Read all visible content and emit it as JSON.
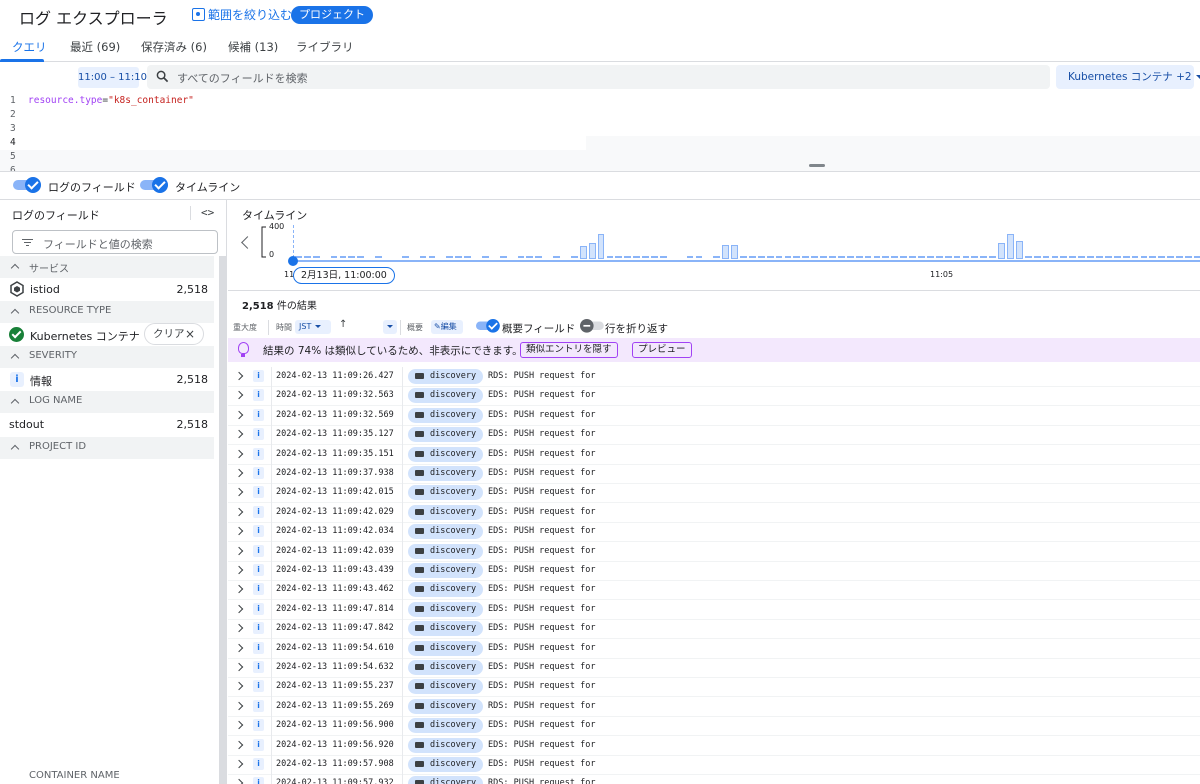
{
  "header": {
    "title": "ログ エクスプローラ",
    "scope_label": "範囲を絞り込む",
    "project_chip": "プロジェクト"
  },
  "tabs": [
    {
      "label": "クエリ",
      "active": true
    },
    {
      "label": "最近 (69)"
    },
    {
      "label": "保存済み (6)"
    },
    {
      "label": "候補 (13)"
    },
    {
      "label": "ライブラリ"
    }
  ],
  "query_bar": {
    "time_range": "11:00 – 11:10",
    "search_placeholder": "すべてのフィールドを検索",
    "resource_button": "Kubernetes コンテナ +2"
  },
  "editor": {
    "line_numbers": [
      "1",
      "2",
      "3",
      "4",
      "5",
      "6"
    ],
    "query_key": "resource.type",
    "query_eq": "=",
    "query_value": "\"k8s_container\""
  },
  "toggles": {
    "log_fields": "ログのフィールド",
    "timeline": "タイムライン"
  },
  "left_panel": {
    "title": "ログのフィールド",
    "code_toggle": "<>",
    "search_placeholder": "フィールドと値の検索",
    "sections": [
      {
        "label": "サービス",
        "items": [
          {
            "label": "istiod",
            "count": "2,518",
            "icon": "hexagon-icon"
          }
        ]
      },
      {
        "label": "RESOURCE TYPE",
        "items": [
          {
            "label": "Kubernetes コンテナ",
            "icon": "check-circle-icon",
            "clear": "クリア"
          }
        ]
      },
      {
        "label": "SEVERITY",
        "items": [
          {
            "label": "情報",
            "count": "2,518",
            "icon": "info-icon"
          }
        ]
      },
      {
        "label": "LOG NAME",
        "items": [
          {
            "label": "stdout",
            "count": "2,518"
          }
        ]
      },
      {
        "label": "PROJECT ID",
        "items": []
      }
    ],
    "cut_off_label": "CONTAINER NAME"
  },
  "timeline": {
    "title": "タイムライン",
    "y_max": "400",
    "y_min": "0",
    "x_start": "11",
    "x_mid": "11:05",
    "cursor_date": "2月13日, 11:00:00",
    "y_range": [
      0,
      400
    ],
    "bucket_counts": [
      3,
      3,
      3,
      0,
      3,
      3,
      3,
      3,
      0,
      3,
      0,
      0,
      3,
      0,
      3,
      3,
      0,
      3,
      3,
      3,
      0,
      3,
      0,
      3,
      0,
      3,
      3,
      3,
      0,
      3,
      0,
      3,
      160,
      190,
      300,
      3,
      3,
      3,
      3,
      3,
      3,
      3,
      0,
      0,
      3,
      3,
      0,
      3,
      170,
      170,
      3,
      3,
      3,
      3,
      3,
      3,
      3,
      3,
      3,
      3,
      3,
      3,
      3,
      3,
      3,
      3,
      3,
      3,
      3,
      3,
      3,
      3,
      3,
      3,
      3,
      3,
      3,
      3,
      3,
      200,
      300,
      220,
      3,
      3,
      3,
      3,
      3,
      3,
      3,
      3,
      3,
      3,
      3,
      3,
      3,
      3,
      3,
      3,
      3,
      3,
      3,
      3
    ]
  },
  "results": {
    "count": "2,518",
    "count_suffix": " 件の結果",
    "toolbar": {
      "severity": "重大度",
      "time": "時間",
      "tz": "JST",
      "arrow": "↑",
      "summary": "概要",
      "edit": "編集",
      "summary_fields": "概要フィールド",
      "wrap_lines": "行を折り返す"
    },
    "banner": {
      "text": "結果の 74% は類似しているため、非表示にできます。",
      "hide_button": "類似エントリを隠す",
      "preview_button": "プレビュー"
    },
    "rows": [
      {
        "ts": "2024-02-13 11:09:26.427",
        "chip": "discovery",
        "msg": "RDS: PUSH request for"
      },
      {
        "ts": "2024-02-13 11:09:32.563",
        "chip": "discovery",
        "msg": "EDS: PUSH request for"
      },
      {
        "ts": "2024-02-13 11:09:32.569",
        "chip": "discovery",
        "msg": "EDS: PUSH request for"
      },
      {
        "ts": "2024-02-13 11:09:35.127",
        "chip": "discovery",
        "msg": "EDS: PUSH request for"
      },
      {
        "ts": "2024-02-13 11:09:35.151",
        "chip": "discovery",
        "msg": "EDS: PUSH request for"
      },
      {
        "ts": "2024-02-13 11:09:37.938",
        "chip": "discovery",
        "msg": "EDS: PUSH request for"
      },
      {
        "ts": "2024-02-13 11:09:42.015",
        "chip": "discovery",
        "msg": "EDS: PUSH request for"
      },
      {
        "ts": "2024-02-13 11:09:42.029",
        "chip": "discovery",
        "msg": "EDS: PUSH request for"
      },
      {
        "ts": "2024-02-13 11:09:42.034",
        "chip": "discovery",
        "msg": "EDS: PUSH request for"
      },
      {
        "ts": "2024-02-13 11:09:42.039",
        "chip": "discovery",
        "msg": "EDS: PUSH request for"
      },
      {
        "ts": "2024-02-13 11:09:43.439",
        "chip": "discovery",
        "msg": "EDS: PUSH request for"
      },
      {
        "ts": "2024-02-13 11:09:43.462",
        "chip": "discovery",
        "msg": "EDS: PUSH request for"
      },
      {
        "ts": "2024-02-13 11:09:47.814",
        "chip": "discovery",
        "msg": "EDS: PUSH request for"
      },
      {
        "ts": "2024-02-13 11:09:47.842",
        "chip": "discovery",
        "msg": "EDS: PUSH request for"
      },
      {
        "ts": "2024-02-13 11:09:54.610",
        "chip": "discovery",
        "msg": "EDS: PUSH request for"
      },
      {
        "ts": "2024-02-13 11:09:54.632",
        "chip": "discovery",
        "msg": "EDS: PUSH request for"
      },
      {
        "ts": "2024-02-13 11:09:55.237",
        "chip": "discovery",
        "msg": "EDS: PUSH request for"
      },
      {
        "ts": "2024-02-13 11:09:55.269",
        "chip": "discovery",
        "msg": "RDS: PUSH request for"
      },
      {
        "ts": "2024-02-13 11:09:56.900",
        "chip": "discovery",
        "msg": "EDS: PUSH request for"
      },
      {
        "ts": "2024-02-13 11:09:56.920",
        "chip": "discovery",
        "msg": "EDS: PUSH request for"
      },
      {
        "ts": "2024-02-13 11:09:57.908",
        "chip": "discovery",
        "msg": "EDS: PUSH request for"
      },
      {
        "ts": "2024-02-13 11:09:57.932",
        "chip": "discovery",
        "msg": "RDS: PUSH request for"
      }
    ]
  },
  "colors": {
    "accent": "#1a73e8",
    "banner_bg": "#f3e8fd",
    "chip_bg": "#d2e3fc",
    "success": "#188038"
  }
}
